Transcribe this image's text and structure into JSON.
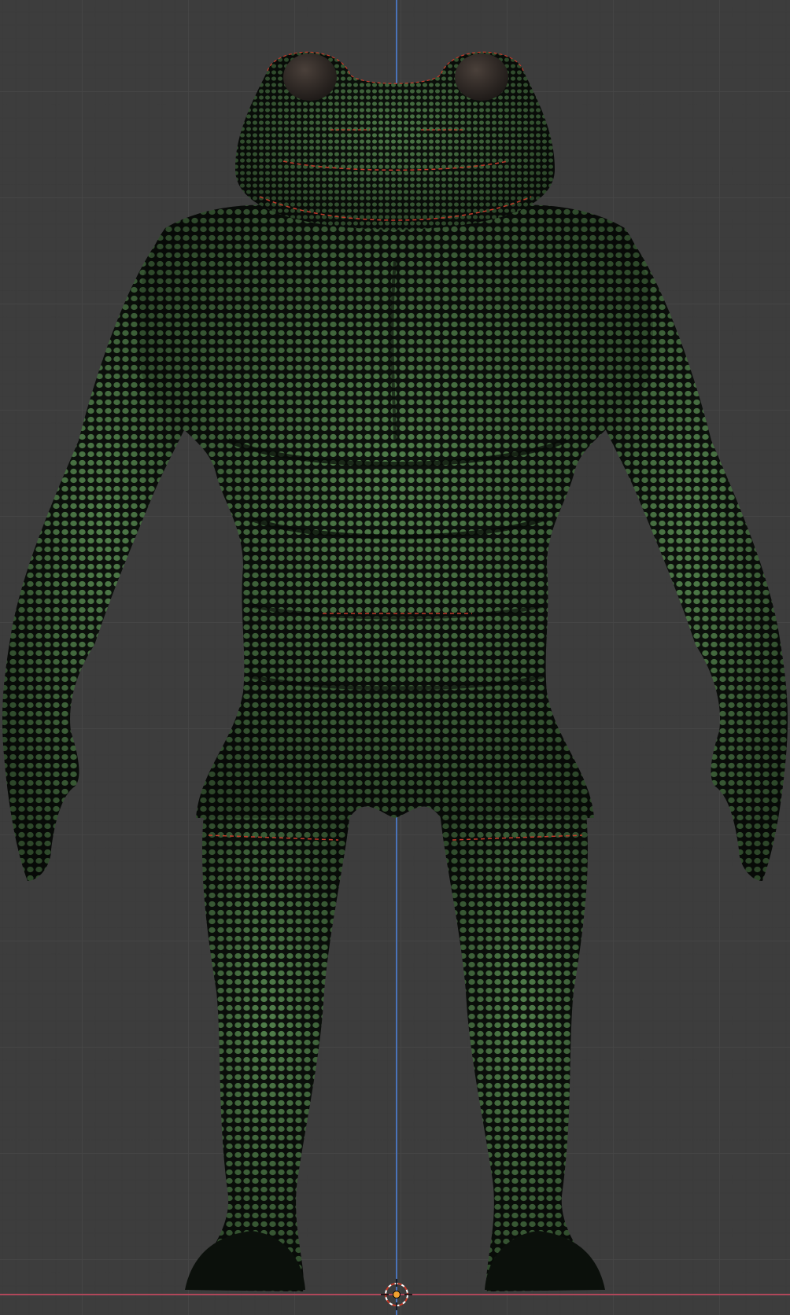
{
  "viewport": {
    "grid_color": "#464646",
    "background_color": "#3d3d3d",
    "z_axis_color": "#4a73b8",
    "x_axis_color": "#b0475a"
  },
  "model": {
    "mesh_face_color": "#4f7d4a",
    "mesh_edge_color": "#0d120d",
    "seam_color": "#c23a2a",
    "eye_color": "#2a2420",
    "display_mode": "wireframe-overlay"
  },
  "cursor": {
    "icon": "3d-cursor-icon",
    "color": "#f0a030"
  }
}
